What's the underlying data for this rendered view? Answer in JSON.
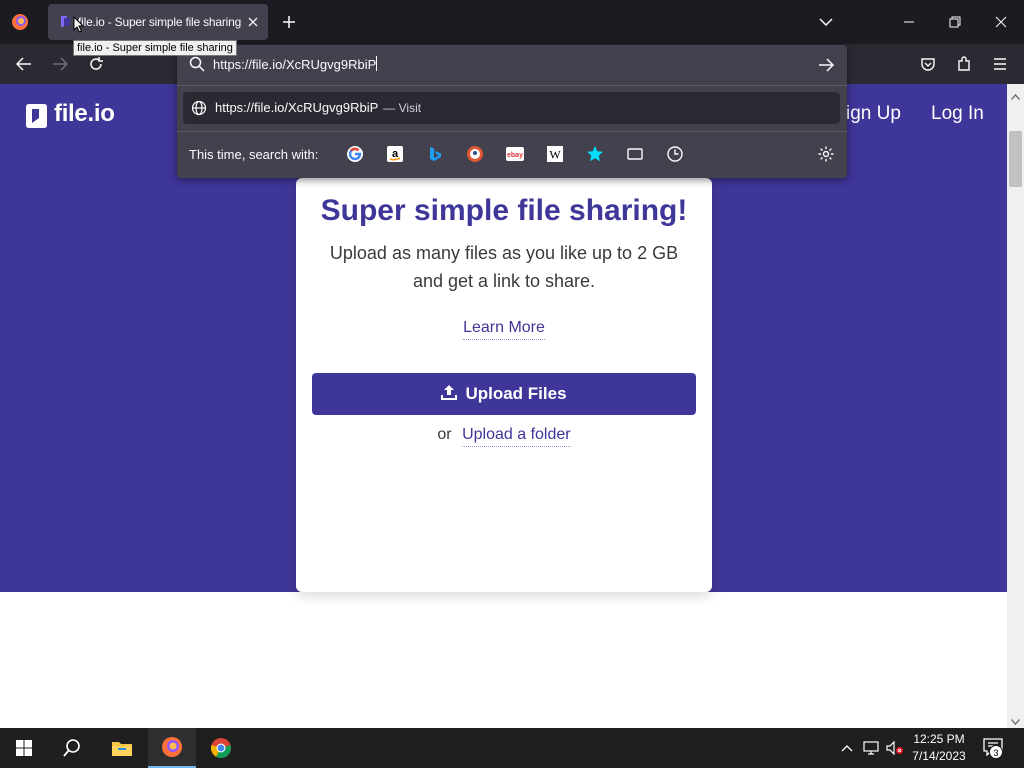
{
  "browser": {
    "tab": {
      "title": "file.io - Super simple file sharing",
      "tooltip": "file.io - Super simple file sharing"
    },
    "url_bar": {
      "value": "https://file.io/XcRUgvg9RbiP",
      "result": {
        "url": "https://file.io/XcRUgvg9RbiP",
        "action": "— Visit"
      },
      "search_with_label": "This time, search with:",
      "engines": [
        "Google",
        "Amazon",
        "Bing",
        "DuckDuckGo",
        "eBay",
        "Wikipedia",
        "Bookmarks",
        "Tabs",
        "History"
      ]
    },
    "icons": [
      "firefox-menu-icon",
      "back-icon",
      "forward-icon",
      "reload-icon",
      "pocket-icon",
      "extensions-icon",
      "menu-icon"
    ]
  },
  "site": {
    "logo_text": "file.io",
    "nav": {
      "signup": "ign Up",
      "login": "Log In"
    },
    "card": {
      "title": "Super simple file sharing!",
      "subtitle": "Upload as many files as you like up to 2 GB and get a link to share.",
      "learn_more": "Learn More",
      "upload_button": "Upload Files",
      "or": "or",
      "upload_folder": "Upload a folder"
    }
  },
  "taskbar": {
    "time": "12:25 PM",
    "date": "7/14/2023",
    "notification_count": "3"
  },
  "colors": {
    "brand": "#3f3699",
    "browser_dark": "#1c1b22",
    "toolbar": "#2b2a33",
    "panel": "#42414d"
  }
}
